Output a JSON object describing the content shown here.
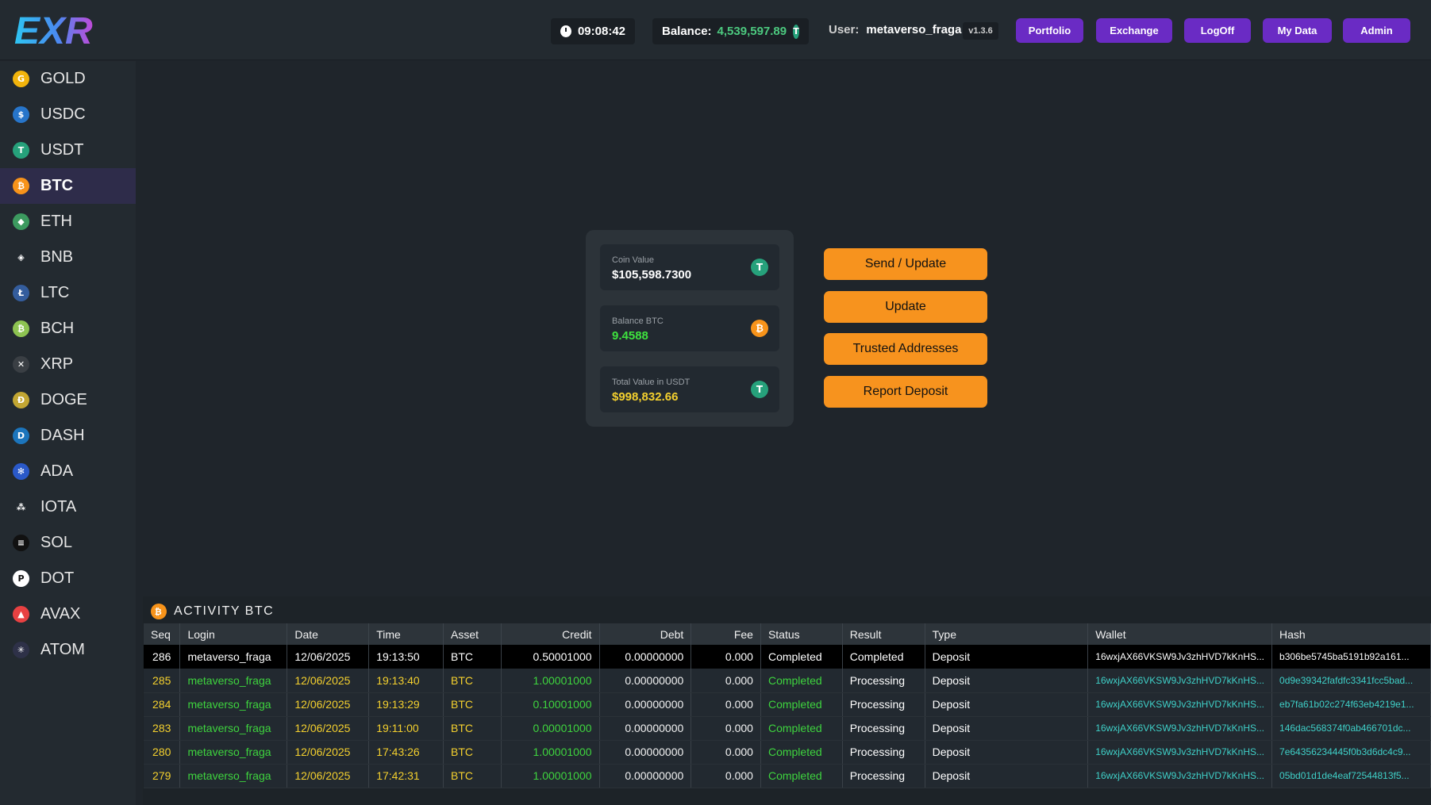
{
  "header": {
    "logo_text": "EXR",
    "clock": "09:08:42",
    "balance_label": "Balance:",
    "balance_value": "4,539,597.89",
    "user_label": "User:",
    "user_name": "metaverso_fraga",
    "version": "v1.3.6",
    "nav": [
      "Portfolio",
      "Exchange",
      "LogOff",
      "My Data",
      "Admin"
    ]
  },
  "sidebar": {
    "active": "BTC",
    "items": [
      {
        "label": "GOLD",
        "icon": "gold-icon",
        "color": "#f2b40c",
        "glyph": "G"
      },
      {
        "label": "USDC",
        "icon": "usdc-icon",
        "color": "#2775ca",
        "glyph": "$"
      },
      {
        "label": "USDT",
        "icon": "usdt-icon",
        "color": "#26a17b",
        "glyph": "T"
      },
      {
        "label": "BTC",
        "icon": "btc-icon",
        "color": "#f7931a",
        "glyph": "₿"
      },
      {
        "label": "ETH",
        "icon": "eth-icon",
        "color": "#3c9a5f",
        "glyph": "◆"
      },
      {
        "label": "BNB",
        "icon": "bnb-icon",
        "color": "#232a30",
        "glyph": "◈"
      },
      {
        "label": "LTC",
        "icon": "ltc-icon",
        "color": "#345d9d",
        "glyph": "Ł"
      },
      {
        "label": "BCH",
        "icon": "bch-icon",
        "color": "#8dc351",
        "glyph": "₿"
      },
      {
        "label": "XRP",
        "icon": "xrp-icon",
        "color": "#3a3f44",
        "glyph": "✕"
      },
      {
        "label": "DOGE",
        "icon": "doge-icon",
        "color": "#c2a633",
        "glyph": "Ð"
      },
      {
        "label": "DASH",
        "icon": "dash-icon",
        "color": "#1c75bc",
        "glyph": "D"
      },
      {
        "label": "ADA",
        "icon": "ada-icon",
        "color": "#2a59c9",
        "glyph": "✻"
      },
      {
        "label": "IOTA",
        "icon": "iota-icon",
        "color": "#232a30",
        "glyph": "⁂"
      },
      {
        "label": "SOL",
        "icon": "sol-icon",
        "color": "#111111",
        "glyph": "≡"
      },
      {
        "label": "DOT",
        "icon": "dot-icon",
        "color": "#ffffff",
        "glyph": "P"
      },
      {
        "label": "AVAX",
        "icon": "avax-icon",
        "color": "#e84142",
        "glyph": "▲"
      },
      {
        "label": "ATOM",
        "icon": "atom-icon",
        "color": "#2e3148",
        "glyph": "✳"
      }
    ]
  },
  "summary": {
    "coin_value_label": "Coin Value",
    "coin_value": "$105,598.7300",
    "balance_label": "Balance BTC",
    "balance_value": "9.4588",
    "total_label": "Total Value in USDT",
    "total_value": "$998,832.66"
  },
  "actions": [
    "Send / Update",
    "Update",
    "Trusted Addresses",
    "Report Deposit"
  ],
  "activity": {
    "title": "ACTIVITY BTC",
    "columns": [
      "Seq",
      "Login",
      "Date",
      "Time",
      "Asset",
      "Credit",
      "Debt",
      "Fee",
      "Status",
      "Result",
      "Type",
      "Wallet",
      "Hash"
    ],
    "rows": [
      {
        "seq": "286",
        "login": "metaverso_fraga",
        "date": "12/06/2025",
        "time": "19:13:50",
        "asset": "BTC",
        "credit": "0.50001000",
        "debt": "0.00000000",
        "fee": "0.000",
        "status": "Completed",
        "result": "Completed",
        "type": "Deposit",
        "wallet": "16wxjAX66VKSW9Jv3zhHVD7kKnHS...",
        "hash": "b306be5745ba5191b92a161..."
      },
      {
        "seq": "285",
        "login": "metaverso_fraga",
        "date": "12/06/2025",
        "time": "19:13:40",
        "asset": "BTC",
        "credit": "1.00001000",
        "debt": "0.00000000",
        "fee": "0.000",
        "status": "Completed",
        "result": "Processing",
        "type": "Deposit",
        "wallet": "16wxjAX66VKSW9Jv3zhHVD7kKnHS...",
        "hash": "0d9e39342fafdfc3341fcc5bad..."
      },
      {
        "seq": "284",
        "login": "metaverso_fraga",
        "date": "12/06/2025",
        "time": "19:13:29",
        "asset": "BTC",
        "credit": "0.10001000",
        "debt": "0.00000000",
        "fee": "0.000",
        "status": "Completed",
        "result": "Processing",
        "type": "Deposit",
        "wallet": "16wxjAX66VKSW9Jv3zhHVD7kKnHS...",
        "hash": "eb7fa61b02c274f63eb4219e1..."
      },
      {
        "seq": "283",
        "login": "metaverso_fraga",
        "date": "12/06/2025",
        "time": "19:11:00",
        "asset": "BTC",
        "credit": "0.00001000",
        "debt": "0.00000000",
        "fee": "0.000",
        "status": "Completed",
        "result": "Processing",
        "type": "Deposit",
        "wallet": "16wxjAX66VKSW9Jv3zhHVD7kKnHS...",
        "hash": "146dac568374f0ab466701dc..."
      },
      {
        "seq": "280",
        "login": "metaverso_fraga",
        "date": "12/06/2025",
        "time": "17:43:26",
        "asset": "BTC",
        "credit": "1.00001000",
        "debt": "0.00000000",
        "fee": "0.000",
        "status": "Completed",
        "result": "Processing",
        "type": "Deposit",
        "wallet": "16wxjAX66VKSW9Jv3zhHVD7kKnHS...",
        "hash": "7e64356234445f0b3d6dc4c9..."
      },
      {
        "seq": "279",
        "login": "metaverso_fraga",
        "date": "12/06/2025",
        "time": "17:42:31",
        "asset": "BTC",
        "credit": "1.00001000",
        "debt": "0.00000000",
        "fee": "0.000",
        "status": "Completed",
        "result": "Processing",
        "type": "Deposit",
        "wallet": "16wxjAX66VKSW9Jv3zhHVD7kKnHS...",
        "hash": "05bd01d1de4eaf72544813f5..."
      }
    ]
  },
  "colors": {
    "accent_purple": "#6a2bc4",
    "accent_orange": "#f7931e",
    "positive_green": "#3ed43e",
    "value_yellow": "#f4d02e"
  }
}
